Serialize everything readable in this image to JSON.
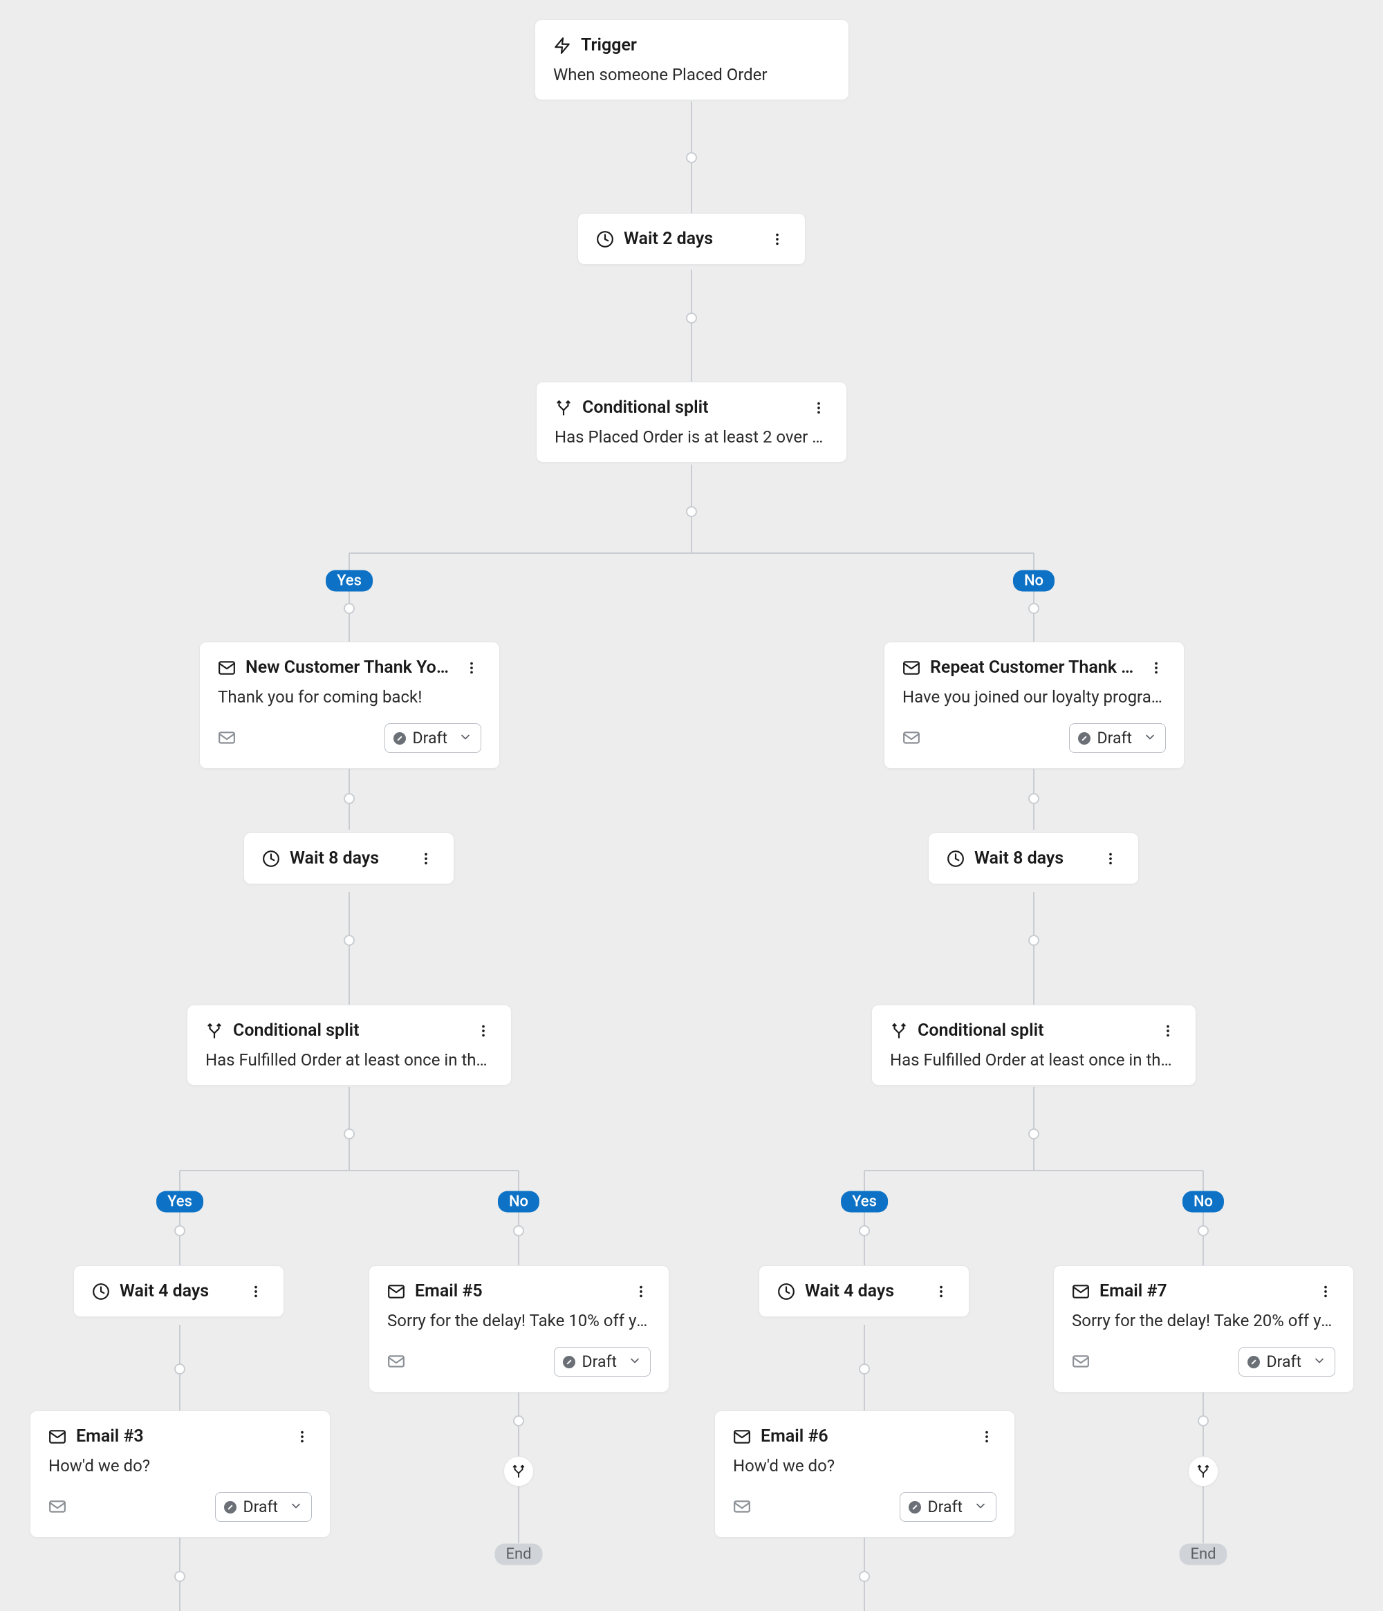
{
  "trigger": {
    "title": "Trigger",
    "desc": "When someone Placed Order"
  },
  "wait2": {
    "title": "Wait 2 days"
  },
  "split1": {
    "title": "Conditional split",
    "desc": "Has Placed Order is at least 2 over all time."
  },
  "labels": {
    "yes": "Yes",
    "no": "No",
    "end": "End",
    "draft": "Draft"
  },
  "leftEmail": {
    "title": "New Customer Thank You:...",
    "desc": "Thank you for coming back!"
  },
  "rightEmail": {
    "title": "Repeat Customer Thank You:...",
    "desc": "Have you joined our loyalty program?"
  },
  "wait8": {
    "title": "Wait 8 days"
  },
  "split2": {
    "title": "Conditional split",
    "desc": "Has Fulfilled Order at least once in the las..."
  },
  "wait4": {
    "title": "Wait 4 days"
  },
  "email5": {
    "title": "Email #5",
    "desc": "Sorry for the delay! Take 10% off your ne..."
  },
  "email7": {
    "title": "Email #7",
    "desc": "Sorry for the delay! Take 20% off your ne..."
  },
  "email3": {
    "title": "Email #3",
    "desc": "How'd we do?"
  },
  "email6": {
    "title": "Email #6",
    "desc": "How'd we do?"
  }
}
